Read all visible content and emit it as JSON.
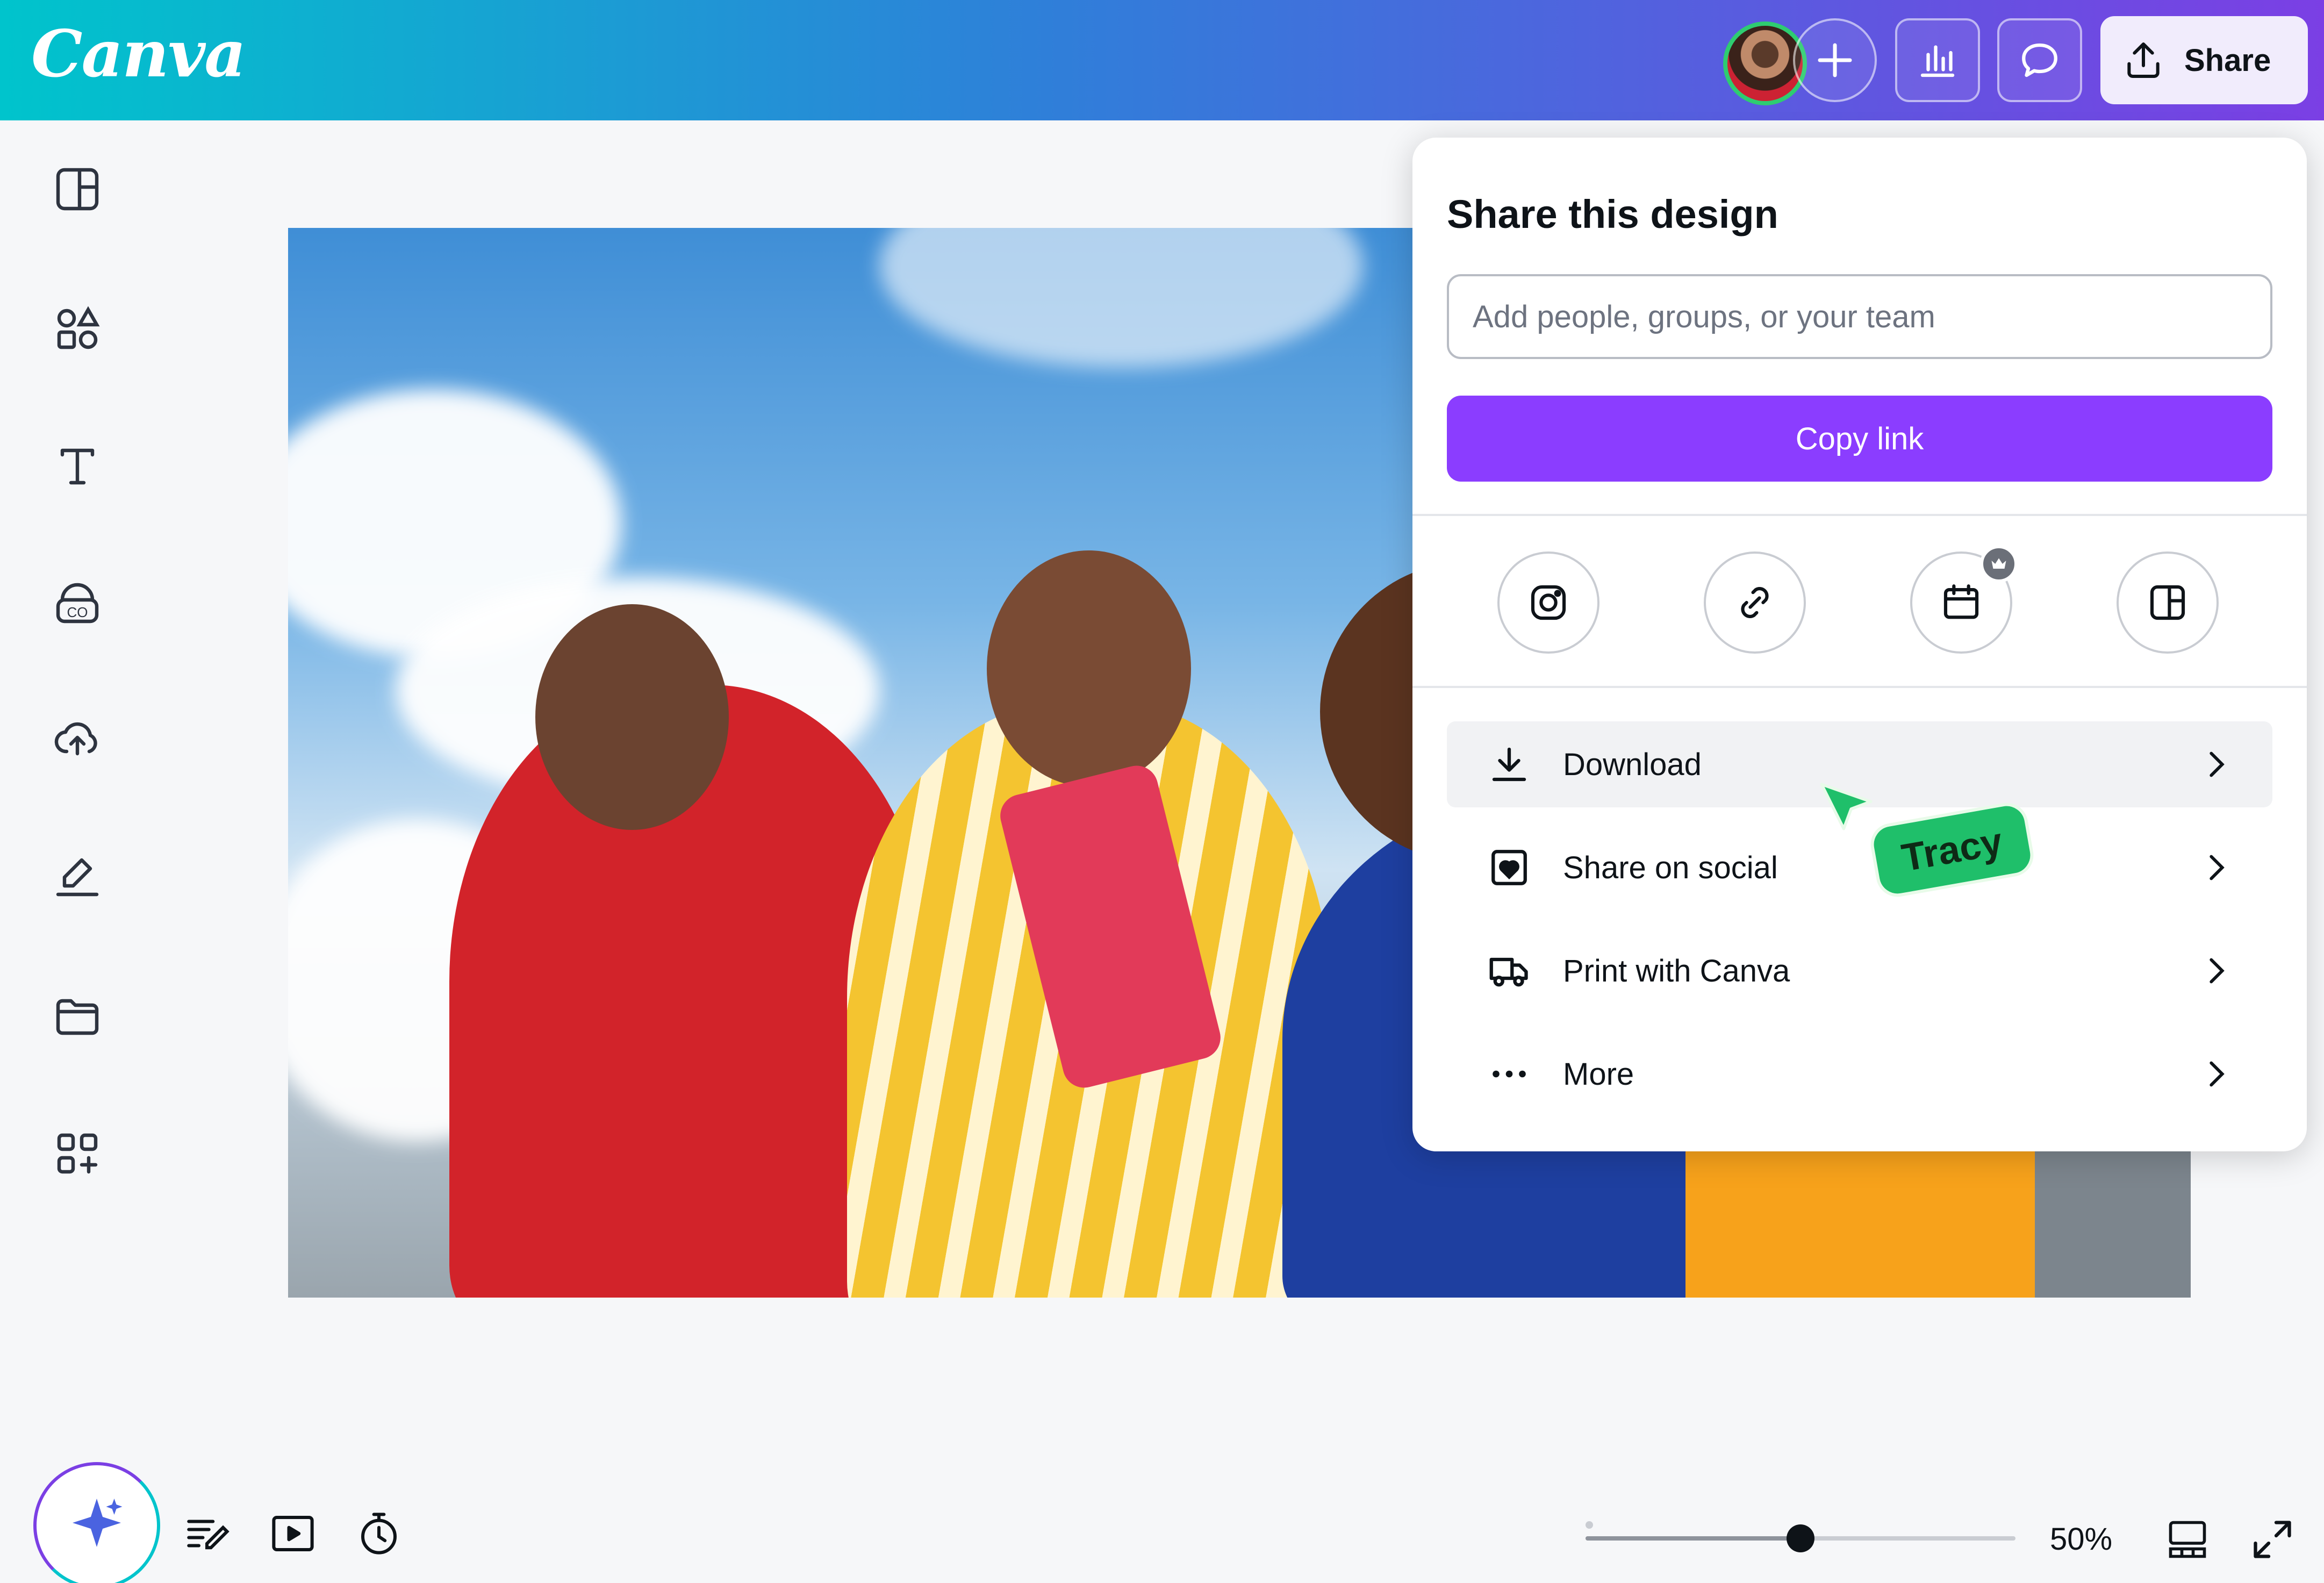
{
  "header": {
    "logo": "Canva",
    "share_label": "Share"
  },
  "share_panel": {
    "title": "Share this design",
    "input_placeholder": "Add people, groups, or your team",
    "copy_link_label": "Copy link",
    "quick_icons": [
      "instagram-icon",
      "link-icon",
      "calendar-icon",
      "canva-icon"
    ],
    "menu": [
      {
        "label": "Download",
        "icon": "download-icon"
      },
      {
        "label": "Share on social",
        "icon": "heart-icon"
      },
      {
        "label": "Print with Canva",
        "icon": "truck-icon"
      },
      {
        "label": "More",
        "icon": "more-icon"
      }
    ]
  },
  "collaborator": {
    "name": "Tracy"
  },
  "bottom_bar": {
    "zoom_percent": 50,
    "zoom_label": "50%"
  },
  "colors": {
    "primary_purple": "#8b3dff",
    "cursor_green": "#1fbf6a",
    "gradient_start": "#00c4cc",
    "gradient_end": "#7b3fe4"
  }
}
